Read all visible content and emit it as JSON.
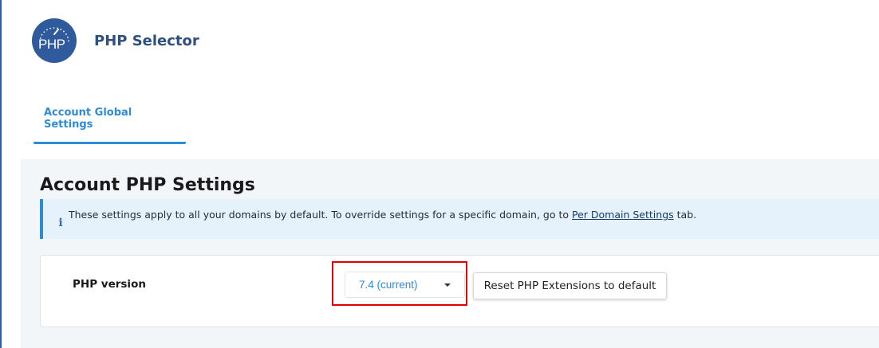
{
  "app": {
    "logo_text": "PHP",
    "title": "PHP Selector"
  },
  "tabs": [
    {
      "label": "Account Global Settings",
      "active": true
    }
  ],
  "section": {
    "title": "Account PHP Settings"
  },
  "notice": {
    "icon": "info-icon",
    "text_before": "These settings apply to all your domains by default. To override settings for a specific domain, go to ",
    "link_text": "Per Domain Settings",
    "text_after": " tab."
  },
  "php_version": {
    "label": "PHP version",
    "selected": "7.4 (current)"
  },
  "buttons": {
    "reset_label": "Reset PHP Extensions to default"
  },
  "colors": {
    "accent": "#2e8bd8",
    "logo_bg": "#2f5a9c",
    "highlight": "#e00000"
  }
}
